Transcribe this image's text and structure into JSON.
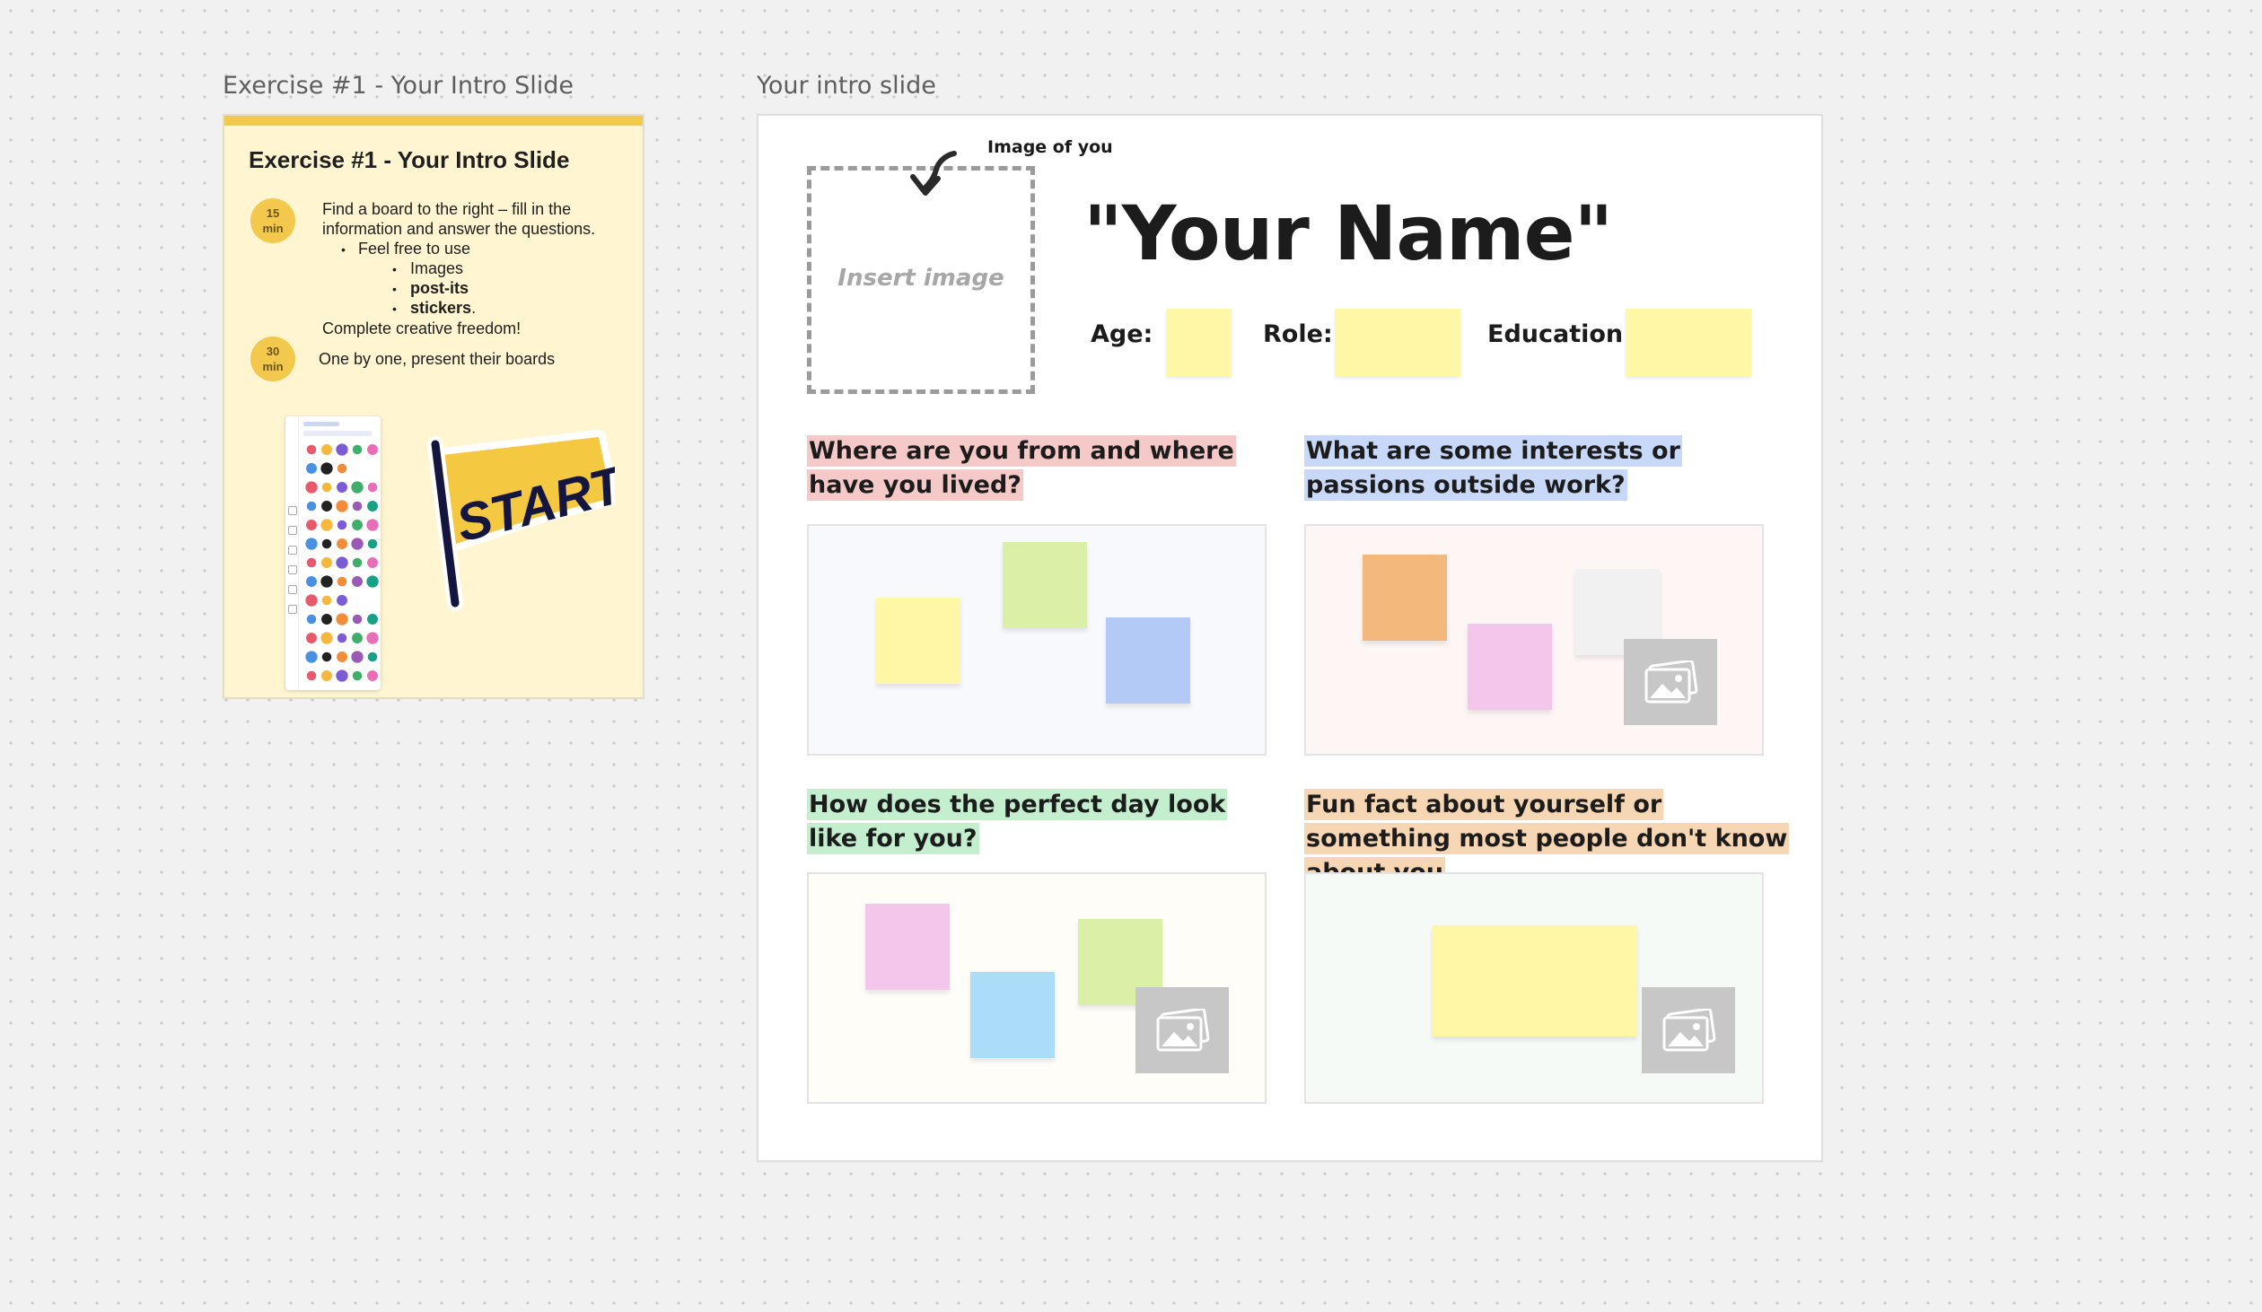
{
  "canvas": {
    "frames": [
      {
        "title": "Exercise #1 - Your Intro Slide"
      },
      {
        "title": "Your intro slide"
      }
    ]
  },
  "exercise": {
    "title": "Exercise #1 - Your Intro Slide",
    "step1": {
      "badge_number": "15",
      "badge_unit": "min",
      "line1": "Find a board to the right – fill in the",
      "line2": "information and answer the questions.",
      "bullet": "Feel free to use",
      "sub_items": [
        "Images",
        "post-its",
        "stickers"
      ],
      "sub_suffix": ".",
      "closing": "Complete creative freedom!"
    },
    "step2": {
      "badge_number": "30",
      "badge_unit": "min",
      "text": "One by one, present their boards"
    },
    "flag_text": "START",
    "colors": {
      "accent": "#f2c94c",
      "card_bg": "#fff5d1"
    }
  },
  "intro": {
    "image_label": "Image of you",
    "insert_image": "Insert image",
    "name": "\"Your Name\"",
    "fields": {
      "age": "Age:",
      "role": "Role:",
      "education": "Education:"
    },
    "questions": [
      {
        "text": "Where are you from and where have you lived?",
        "highlight": "#f6c9c9"
      },
      {
        "text": "What are some interests or passions outside work?",
        "highlight": "#c8d8f8"
      },
      {
        "text": "How does the perfect day look like for you?",
        "highlight": "#c3efce"
      },
      {
        "text": "Fun fact about yourself or something most people don't know about you",
        "highlight": "#f7d6b4"
      }
    ],
    "note_colors": {
      "yellow": "#fff7a6",
      "green": "#d9f0a6",
      "blue": "#b3caf7",
      "orange": "#f2b87c",
      "pink": "#f4c6ec",
      "light_gray": "#f1f1f1",
      "cyan": "#acddf8",
      "image_placeholder": "#c7c7c7"
    },
    "icons": [
      "curved-arrow-icon",
      "image-placeholder-icon"
    ]
  }
}
